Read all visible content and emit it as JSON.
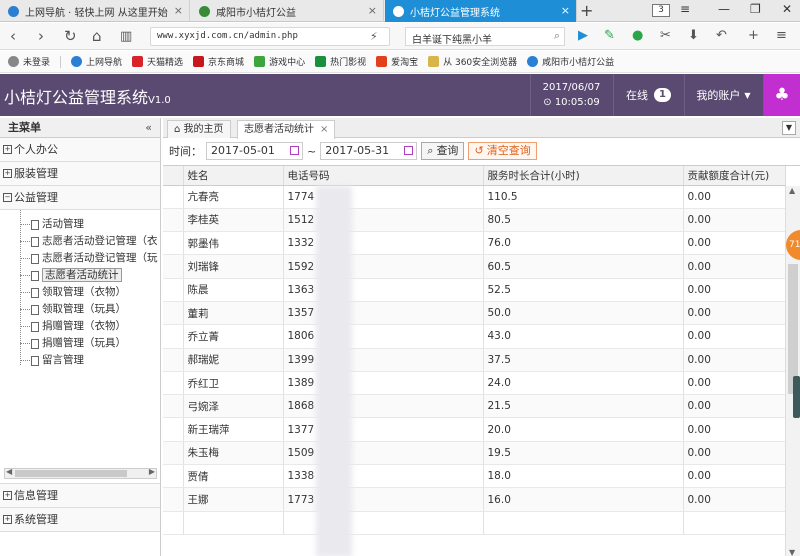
{
  "browser": {
    "tabs": [
      {
        "label": "上网导航 · 轻快上网 从这里开始",
        "active": false
      },
      {
        "label": "咸阳市小桔灯公益",
        "active": false
      },
      {
        "label": "小桔灯公益管理系统",
        "active": true
      }
    ],
    "tab_count": "3",
    "url": "www.xyxjd.com.cn/admin.php",
    "search_value": "白羊诞下纯黑小羊",
    "bookmarks": [
      "未登录",
      "上网导航",
      "天猫精选",
      "京东商城",
      "游戏中心",
      "热门影视",
      "爱淘宝",
      "从 360安全浏览器",
      "咸阳市小桔灯公益"
    ],
    "colors": {
      "active_tab": "#1e8fd6"
    }
  },
  "header": {
    "title": "小桔灯公益管理系统",
    "version": "V1.0",
    "date": "2017/06/07",
    "time": "10:05:09",
    "online_label": "在线",
    "online_count": "1",
    "account_label": "我的账户",
    "colors": {
      "bar": "#5a4a72",
      "accent": "#c12fd1"
    }
  },
  "sidebar": {
    "title": "主菜单",
    "collapse_glyph": "«",
    "sections": [
      {
        "label": "个人办公",
        "toggle": "+"
      },
      {
        "label": "服装管理",
        "toggle": "+"
      },
      {
        "label": "公益管理",
        "toggle": "−"
      },
      {
        "label": "信息管理",
        "toggle": "+"
      },
      {
        "label": "系统管理",
        "toggle": "+"
      }
    ],
    "tree_items": [
      "活动管理",
      "志愿者活动登记管理（衣",
      "志愿者活动登记管理（玩",
      "志愿者活动统计",
      "领取管理（衣物）",
      "领取管理（玩具）",
      "捐赠管理（衣物）",
      "捐赠管理（玩具）",
      "留言管理"
    ],
    "selected_item": "志愿者活动统计"
  },
  "content": {
    "tabs": [
      {
        "label": "我的主页",
        "icon": "home-icon"
      },
      {
        "label": "志愿者活动统计",
        "closable": true
      }
    ],
    "filter": {
      "label": "时间：",
      "start": "2017-05-01",
      "end": "2017-05-31",
      "separator": "~",
      "query_label": "查询",
      "clear_label": "清空查询"
    },
    "table": {
      "columns": [
        "姓名",
        "电话号码",
        "服务时长合计(小时)",
        "贡献额度合计(元)"
      ],
      "rows": [
        [
          "亢春亮",
          "1774",
          "110.5",
          "0.00"
        ],
        [
          "李桂英",
          "1512",
          "80.5",
          "0.00"
        ],
        [
          "郭墨伟",
          "1332",
          "76.0",
          "0.00"
        ],
        [
          "刘瑞锋",
          "1592",
          "60.5",
          "0.00"
        ],
        [
          "陈晨",
          "1363",
          "52.5",
          "0.00"
        ],
        [
          "董莉",
          "1357",
          "50.0",
          "0.00"
        ],
        [
          "乔立菁",
          "1806",
          "43.0",
          "0.00"
        ],
        [
          "郝瑞妮",
          "1399",
          "37.5",
          "0.00"
        ],
        [
          "乔红卫",
          "1389",
          "24.0",
          "0.00"
        ],
        [
          "弓婉泽",
          "1868",
          "21.5",
          "0.00"
        ],
        [
          "新王瑞萍",
          "1377",
          "20.0",
          "0.00"
        ],
        [
          "朱玉梅",
          "1509",
          "19.5",
          "0.00"
        ],
        [
          "贾倩",
          "1338",
          "18.0",
          "0.00"
        ],
        [
          "王娜",
          "1773",
          "16.0",
          "0.00"
        ],
        [
          "",
          "",
          "",
          ""
        ]
      ]
    }
  },
  "floating": {
    "bubble_text": "71"
  }
}
